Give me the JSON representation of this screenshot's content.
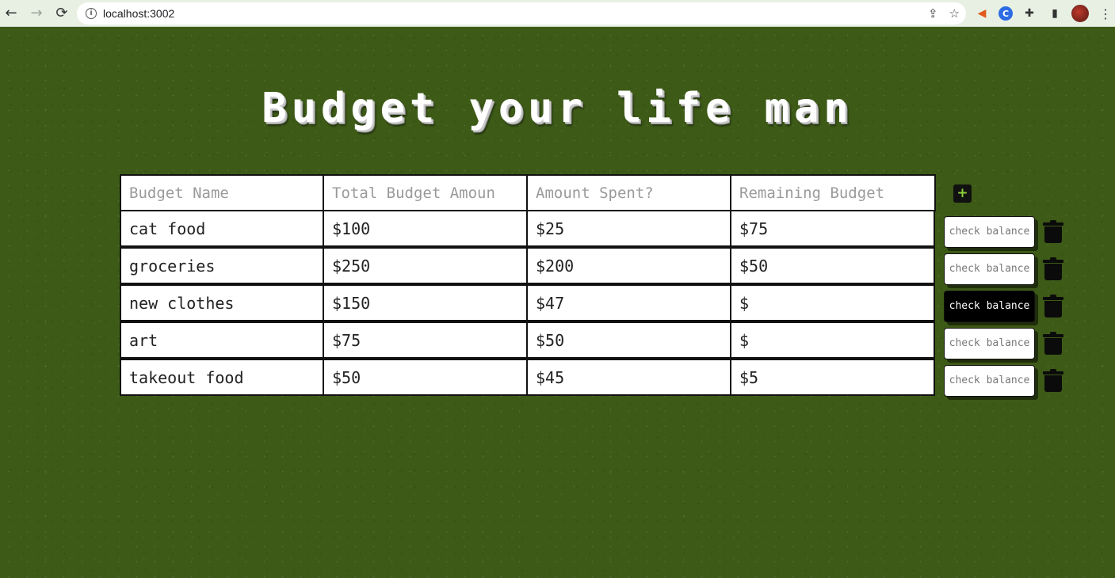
{
  "browser": {
    "url": "localhost:3002",
    "back_icon": "←",
    "forward_icon": "→",
    "reload_icon": "⟳"
  },
  "page": {
    "title": "Budget your life man"
  },
  "table": {
    "placeholders": [
      "Budget Name",
      "Total Budget Amount",
      "Amount Spent?",
      "Remaining Budget"
    ],
    "header_visible": [
      "Budget Name",
      "Total Budget Amoun",
      "Amount Spent?",
      "Remaining Budget"
    ],
    "rows": [
      {
        "name": "cat food",
        "total": "$100",
        "spent": "$25",
        "remaining": "$75"
      },
      {
        "name": "groceries",
        "total": "$250",
        "spent": "$200",
        "remaining": "$50"
      },
      {
        "name": "new clothes",
        "total": "$150",
        "spent": "$47",
        "remaining": "$"
      },
      {
        "name": "art",
        "total": "$75",
        "spent": "$50",
        "remaining": "$"
      },
      {
        "name": "takeout food",
        "total": "$50",
        "spent": "$45",
        "remaining": "$5"
      }
    ]
  },
  "actions": {
    "add_label": "+",
    "check_label": "check balance",
    "active_row": 2
  },
  "colors": {
    "background": "#3d5a17",
    "accent_plus": "#8fcf3b"
  }
}
